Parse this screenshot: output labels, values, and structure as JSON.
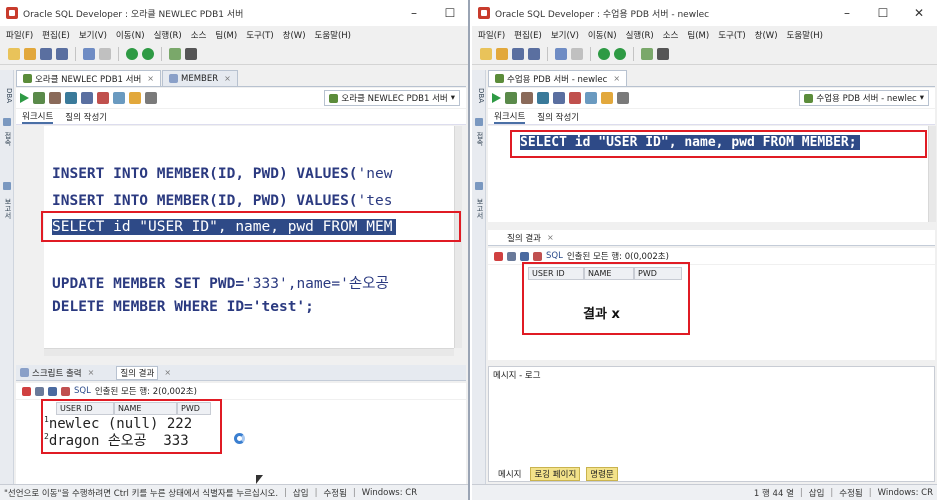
{
  "left": {
    "title": "Oracle SQL Developer : 오라클 NEWLEC PDB1 서버",
    "menu": [
      "파일(F)",
      "편집(E)",
      "보기(V)",
      "이동(N)",
      "실행(R)",
      "소스",
      "팀(M)",
      "도구(T)",
      "창(W)",
      "도움말(H)"
    ],
    "tabs": [
      "오라클 NEWLEC PDB1 서버",
      "MEMBER"
    ],
    "connection": "오라클 NEWLEC PDB1 서버",
    "subtabs": [
      "워크시트",
      "질의 작성기"
    ],
    "sidebar": [
      "DBA",
      "접속",
      "보고서"
    ],
    "code": {
      "line1_kw": "INSERT INTO MEMBER(ID, PWD) VALUES(",
      "line1_str": "'new",
      "line2_kw": "INSERT INTO MEMBER(ID, PWD) VALUES(",
      "line2_str": "'tes",
      "line3": "SELECT id \"USER ID\", name, pwd FROM MEM",
      "line4_kw": "UPDATE MEMBER SET PWD=",
      "line4_rest": "'333',name='손오공",
      "line5": "DELETE MEMBER WHERE ID='test';"
    },
    "bottom_tabs": [
      "스크립트 출력",
      "질의 결과"
    ],
    "sql_label": "SQL",
    "fetch_status": "인출된 모든 행: 2(0,002초)",
    "columns": [
      "USER ID",
      "NAME",
      "PWD"
    ],
    "rows": [
      {
        "n": "1",
        "id": "newlec",
        "name": "(null)",
        "pwd": "222"
      },
      {
        "n": "2",
        "id": "dragon",
        "name": "손오공",
        "pwd": "333"
      }
    ],
    "status": "\"선언으로 이동\"을 수행하려면 Ctrl 키를 누른 상태에서 식별자를 누르십시오.",
    "status_parts": [
      "삽입",
      "수정됨",
      "Windows: CR"
    ]
  },
  "right": {
    "title": "Oracle SQL Developer : 수업용 PDB 서버 - newlec",
    "menu": [
      "파일(F)",
      "편집(E)",
      "보기(V)",
      "이동(N)",
      "실행(R)",
      "소스",
      "팀(M)",
      "도구(T)",
      "창(W)",
      "도움말(H)"
    ],
    "tabs": [
      "수업용 PDB 서버 - newlec"
    ],
    "connection": "수업용 PDB 서버 - newlec",
    "subtabs": [
      "워크시트",
      "질의 작성기"
    ],
    "sidebar": [
      "DBA",
      "접속",
      "보고서"
    ],
    "code_line": "SELECT id \"USER ID\", name, pwd FROM MEMBER;",
    "result_tab": "질의 결과",
    "sql_label": "SQL",
    "fetch_status": "인출된 모든 행: 0(0,002초)",
    "columns": [
      "USER ID",
      "NAME",
      "PWD"
    ],
    "annotation": "결과 x",
    "message_title": "메시지 - 로그",
    "message_tabs": [
      "메시지",
      "로깅 페이지",
      "명령문"
    ],
    "status_parts": [
      "1 행 44 열",
      "삽입",
      "수정됨",
      "Windows: CR"
    ]
  },
  "colors": {
    "accent": "#2e4a87",
    "annotation_red": "#e01b24",
    "keyword": "#2b3a80"
  }
}
